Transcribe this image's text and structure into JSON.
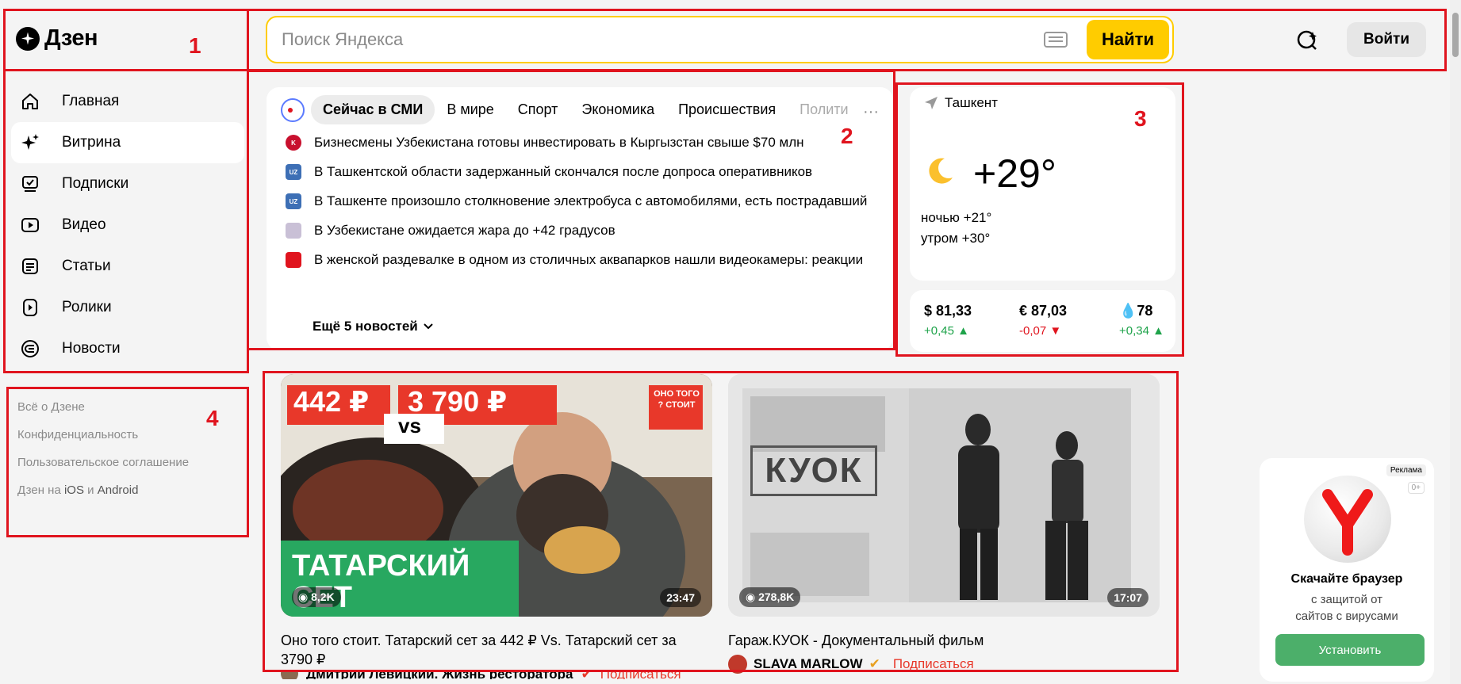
{
  "header": {
    "logo_text": "Дзен",
    "search_placeholder": "Поиск Яндекса",
    "search_button": "Найти",
    "login_button": "Войти"
  },
  "sidebar": {
    "items": [
      {
        "label": "Главная",
        "icon": "home-icon"
      },
      {
        "label": "Витрина",
        "icon": "sparkle-icon"
      },
      {
        "label": "Подписки",
        "icon": "subscriptions-icon"
      },
      {
        "label": "Видео",
        "icon": "video-icon"
      },
      {
        "label": "Статьи",
        "icon": "article-icon"
      },
      {
        "label": "Ролики",
        "icon": "clips-icon"
      },
      {
        "label": "Новости",
        "icon": "news-icon"
      }
    ],
    "footer": {
      "about": "Всё о Дзене",
      "privacy": "Конфиденциальность",
      "agreement": "Пользовательское соглашение",
      "apps_prefix": "Дзен на",
      "apps_ios": "iOS",
      "apps_and": "и",
      "apps_android": "Android"
    }
  },
  "news": {
    "tabs": [
      "Сейчас в СМИ",
      "В мире",
      "Спорт",
      "Экономика",
      "Происшествия",
      "Полити"
    ],
    "items": [
      {
        "text": "Бизнесмены Узбекистана готовы инвестировать в Кыргызстан свыше $70 млн",
        "color": "#c8102e",
        "badge": "K"
      },
      {
        "text": "В Ташкентской области задержанный скончался после допроса оперативников",
        "color": "#3d6fb5",
        "badge": "UZ"
      },
      {
        "text": "В Ташкенте произошло столкновение электробуса с автомобилями, есть пострадавший",
        "color": "#3d6fb5",
        "badge": "UZ"
      },
      {
        "text": "В Узбекистане ожидается жара до +42 градусов",
        "color": "#c9c0d6",
        "badge": ""
      },
      {
        "text": "В женской раздевалке в одном из столичных аквапарков нашли видеокамеры: реакции",
        "color": "#e0141e",
        "badge": ""
      }
    ],
    "more": "Ещё 5 новостей"
  },
  "weather": {
    "city": "Ташкент",
    "temp": "+29°",
    "night": "ночью +21°",
    "morning": "утром +30°"
  },
  "rates": [
    {
      "value": "$ 81,33",
      "delta": "+0,45",
      "dir": "up"
    },
    {
      "value": "€ 87,03",
      "delta": "-0,07",
      "dir": "down"
    },
    {
      "value": "78",
      "delta": "+0,34",
      "dir": "up"
    }
  ],
  "videos": [
    {
      "title": "Оно того стоит. Татарский сет за 442 ₽ Vs. Татарский сет за 3790 ₽",
      "views": "8,2K",
      "duration": "23:47",
      "thumb_price1": "442 ₽",
      "thumb_price2": "3 790 ₽",
      "thumb_vs": "vs",
      "thumb_caption": "ТАТАРСКИЙ СЕТ",
      "thumb_sticker": "ОНО ТОГО ? СТОИТ",
      "channel": "Дмитрий Левицкий. Жизнь ресторатора",
      "subscribe": "Подписаться"
    },
    {
      "title": "Гараж.КУОК - Документальный фильм",
      "views": "278,8K",
      "duration": "17:07",
      "thumb_logo": "КУОК",
      "channel": "SLAVA MARLOW",
      "subscribe": "Подписаться"
    }
  ],
  "ad": {
    "label": "Реклама",
    "age": "0+",
    "title": "Скачайте браузер",
    "subtitle_line1": "с защитой от",
    "subtitle_line2": "сайтов с вирусами",
    "button": "Установить"
  },
  "annotations": [
    "1",
    "2",
    "3",
    "4"
  ]
}
